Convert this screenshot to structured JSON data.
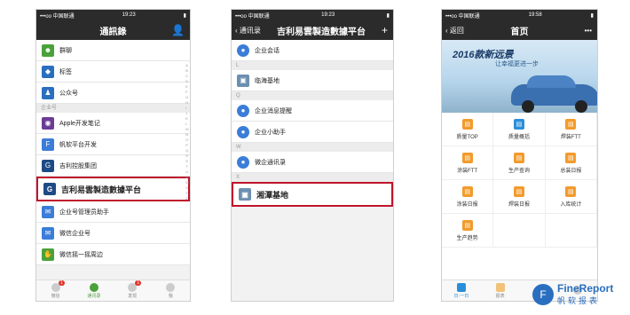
{
  "phone1": {
    "carrier": "•••oo 中国联通",
    "time": "19:23",
    "title": "通訊錄",
    "rows": [
      {
        "label": "群聊",
        "color": "#4aa13a",
        "icon": "group-icon"
      },
      {
        "label": "标签",
        "color": "#2a6fbf",
        "icon": "tag-icon"
      },
      {
        "label": "公众号",
        "color": "#2a6fbf",
        "icon": "official-account-icon"
      }
    ],
    "section": "企业号",
    "rows2": [
      {
        "label": "Apple开发笔记",
        "color": "#6a3c96",
        "icon": "apple-notes-icon"
      },
      {
        "label": "帆软平台开发",
        "color": "#3b7dd8",
        "icon": "finereport-icon"
      },
      {
        "label": "吉利控股集团",
        "color": "#1e4b86",
        "icon": "geely-icon"
      },
      {
        "label": "吉利易雲製造數據平台",
        "color": "#1e4b86",
        "icon": "geely-platform-icon"
      },
      {
        "label": "企业号管理员助手",
        "color": "#3b7dd8",
        "icon": "admin-helper-icon"
      },
      {
        "label": "微信企业号",
        "color": "#3b7dd8",
        "icon": "wechat-enterprise-icon"
      },
      {
        "label": "微信摇一摇周边",
        "color": "#4aa13a",
        "icon": "shake-icon"
      }
    ],
    "tabs": [
      {
        "label": "微信",
        "badge": "1"
      },
      {
        "label": "通讯录",
        "badge": ""
      },
      {
        "label": "发现",
        "badge": "1"
      },
      {
        "label": "我",
        "badge": ""
      }
    ]
  },
  "phone2": {
    "carrier": "•••oo 中国联通",
    "time": "19:23",
    "back": "通讯录",
    "title": "吉利易雲製造數據平台",
    "add": "+",
    "rows": [
      {
        "label": "企业会话",
        "color": "#3b7dd8",
        "icon": "enterprise-chat-icon"
      },
      {
        "label": "临海基地",
        "color": "#6c8fb0",
        "icon": "base-icon"
      },
      {
        "label": "企业消息提醒",
        "color": "#3b7dd8",
        "icon": "reminder-icon"
      },
      {
        "label": "企业小助手",
        "color": "#3b7dd8",
        "icon": "assistant-icon"
      },
      {
        "label": "微企通讯录",
        "color": "#3b7dd8",
        "icon": "contacts-icon"
      },
      {
        "label": "湘潭基地",
        "color": "#6c8fb0",
        "icon": "base-icon"
      }
    ],
    "sections": [
      "L",
      "Q",
      "W",
      "X"
    ]
  },
  "phone3": {
    "carrier": "•••oo 中国联通",
    "time": "19:58",
    "back": "返回",
    "title": "首页",
    "more": "•••",
    "banner_line1": "2016款新远景",
    "banner_line2": "让幸福更进一步",
    "cells": [
      "质量TOP",
      "质量概括",
      "焊装FTT",
      "涂装FTT",
      "生产查询",
      "总装日报",
      "涂装日报",
      "焊装日报",
      "入库统计",
      "生产趋势",
      "",
      ""
    ],
    "tabs": [
      "日·一日",
      "报表",
      "",
      ""
    ]
  },
  "brand": {
    "name": "FineReport",
    "cn": "帆软报表"
  },
  "colors": {
    "accent": "#c0142c",
    "cell_icon": "#f29b2c"
  }
}
